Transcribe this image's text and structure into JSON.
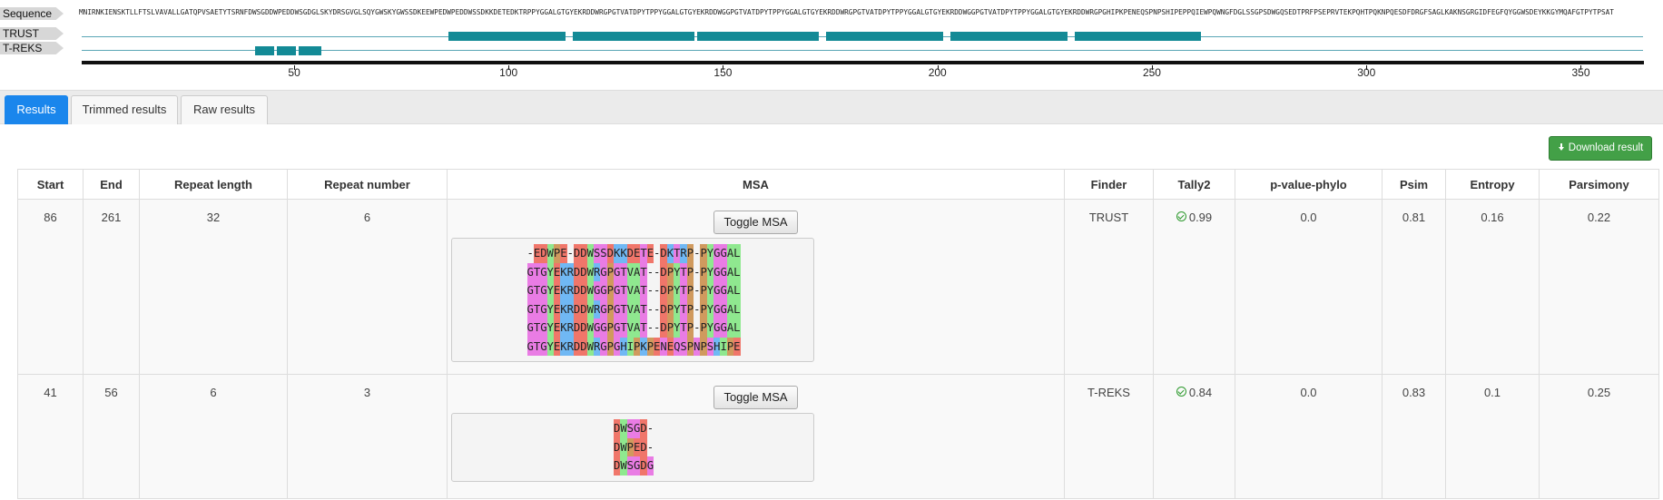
{
  "viewer": {
    "sequence_label": "Sequence",
    "sequence": "MNIRNKIENSKTLLFTSLVAVALLGATQPVSAETYTSRNFDWSGDDWPEDDWSGDGLSKYDRSGVGLSQYGWSKYGWSSDKEEWPEDWPEDDWSSDKKDETEDKTRPPYGGALGTGYEKRDDWRGPGTVATDPYTPPYGGALGTGYEKRDDWGGPGTVATDPYTPPYGGALGTGYEKRDDWRGPGTVATDPYTPPYGGALGTGYEKRDDWGGPGTVATDPYTPPYGGALGTGYEKRDDWRGPGHIPKPENEQSPNPSHIPEPPQIEWPQWNGFDGLSSGPSDWGQSEDTPRFPSEPRVTEKPQHTPQKNPQESDFDRGFSAGLKAKNSGRGIDFEGFQYGGWSDEYKKGYMQAFGTPYTPSAT",
    "sequence_length": 364,
    "tracks": [
      {
        "label": "TRUST",
        "segments": [
          [
            86,
            113
          ],
          [
            115,
            143
          ],
          [
            144,
            172
          ],
          [
            174,
            201
          ],
          [
            203,
            230
          ],
          [
            232,
            261
          ]
        ]
      },
      {
        "label": "T-REKS",
        "segments": [
          [
            41,
            45
          ],
          [
            46,
            50
          ],
          [
            51,
            56
          ]
        ]
      }
    ],
    "ticks": [
      "50",
      "100",
      "150",
      "200",
      "250",
      "300",
      "350"
    ]
  },
  "tabs": [
    "Results",
    "Trimmed results",
    "Raw results"
  ],
  "download_label": "Download result",
  "table": {
    "headers": [
      "Start",
      "End",
      "Repeat length",
      "Repeat number",
      "MSA",
      "Finder",
      "Tally2",
      "p-value-phylo",
      "Psim",
      "Entropy",
      "Parsimony"
    ],
    "rows": [
      {
        "start": "86",
        "end": "261",
        "repeat_length": "32",
        "repeat_number": "6",
        "toggle_label": "Toggle MSA",
        "msa": [
          "-EDWPE-DDWSSDKKDETE-DKTRP-PYGGAL",
          "GTGYEKRDDWRGPGTVAT--DPYTP-PYGGAL",
          "GTGYEKRDDWGGPGTVAT--DPYTP-PYGGAL",
          "GTGYEKRDDWRGPGTVAT--DPYTP-PYGGAL",
          "GTGYEKRDDWGGPGTVAT--DPYTP-PYGGAL",
          "GTGYEKRDDWRGPGHIPKPENEQSPNPSHIPE"
        ],
        "finder": "TRUST",
        "tally2": "0.99",
        "pvalue": "0.0",
        "psim": "0.81",
        "entropy": "0.16",
        "parsimony": "0.22"
      },
      {
        "start": "41",
        "end": "56",
        "repeat_length": "6",
        "repeat_number": "3",
        "toggle_label": "Toggle MSA",
        "msa": [
          "DWSGD-",
          "DWPED-",
          "DWSGDG"
        ],
        "finder": "T-REKS",
        "tally2": "0.84",
        "pvalue": "0.0",
        "psim": "0.83",
        "entropy": "0.1",
        "parsimony": "0.25"
      }
    ]
  },
  "colors": {
    "tab_active": "#1a86ec",
    "download_button": "#43a047",
    "feature": "#138a96",
    "tally_ok": "#2e9a2e"
  }
}
